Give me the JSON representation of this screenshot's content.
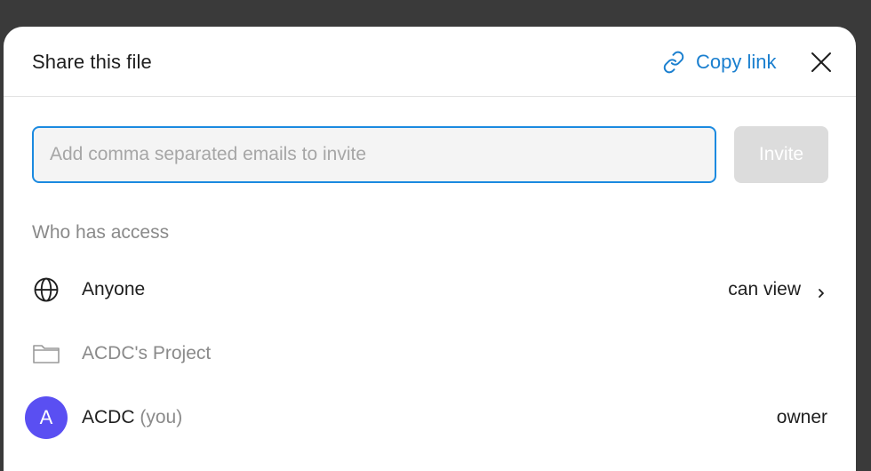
{
  "dialog": {
    "title": "Share this file",
    "copy_link_label": "Copy link",
    "accent_color": "#1a7fcf"
  },
  "invite": {
    "placeholder": "Add comma separated emails to invite",
    "value": "",
    "button_label": "Invite"
  },
  "access": {
    "section_label": "Who has access",
    "rows": [
      {
        "icon": "globe-icon",
        "name": "Anyone",
        "permission": "can view"
      },
      {
        "icon": "folder-icon",
        "name": "ACDC's Project",
        "permission": ""
      },
      {
        "avatar_initial": "A",
        "avatar_color": "#5a4ff2",
        "name": "ACDC",
        "suffix": "(you)",
        "permission": "owner"
      }
    ]
  }
}
